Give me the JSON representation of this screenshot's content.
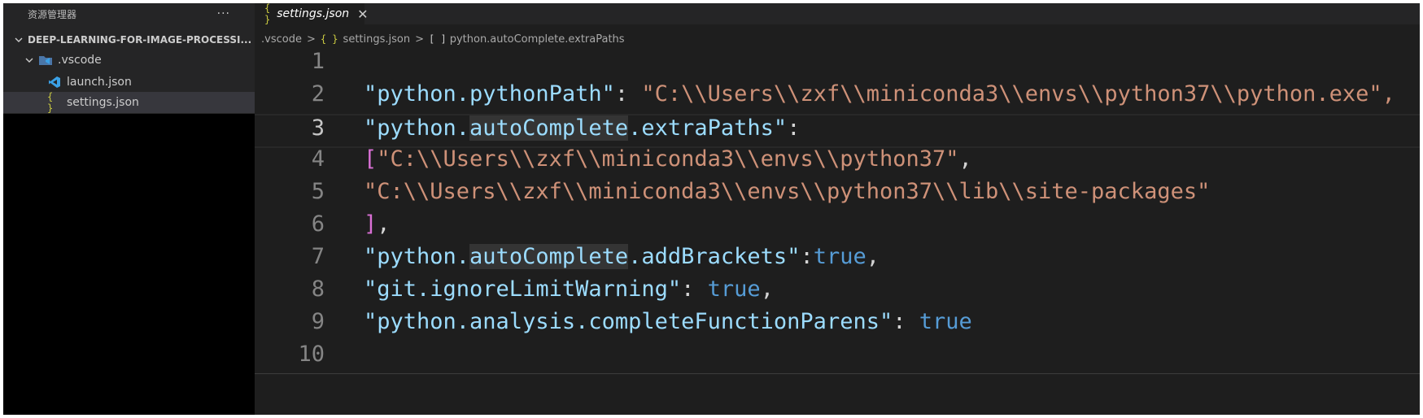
{
  "sidebar": {
    "title": "资源管理器",
    "more": "···",
    "folder": "DEEP-LEARNING-FOR-IMAGE-PROCESSI...",
    "items": [
      {
        "label": ".vscode"
      },
      {
        "label": "launch.json"
      },
      {
        "label": "settings.json"
      }
    ]
  },
  "tab": {
    "label": "settings.json",
    "close": "✕",
    "icon": "{ }"
  },
  "breadcrumb": {
    "parts": [
      ".vscode",
      "settings.json",
      "python.autoComplete.extraPaths"
    ],
    "separator": ">",
    "json_icon": "{ }",
    "array_icon": "[ ]"
  },
  "editor": {
    "line_numbers": [
      "1",
      "2",
      "3",
      "4",
      "5",
      "6",
      "7",
      "8",
      "9",
      "10"
    ],
    "current_line": 3,
    "lines": {
      "l2_key": "\"python.pythonPath\"",
      "l2_colon": ": ",
      "l2_val": "\"C:\\\\Users\\\\zxf\\\\miniconda3\\\\envs\\\\python37\\\\python.exe\",",
      "l3_key_a": "\"python.",
      "l3_key_b": "autoComplete",
      "l3_key_c": ".extraPaths\"",
      "l3_colon": ":",
      "l4_open": "[",
      "l4_val": "\"C:\\\\Users\\\\zxf\\\\miniconda3\\\\envs\\\\python37\"",
      "l4_comma": ",",
      "l5_val": "\"C:\\\\Users\\\\zxf\\\\miniconda3\\\\envs\\\\python37\\\\lib\\\\site-packages\"",
      "l6_close": "]",
      "l6_comma": ",",
      "l7_key_a": "\"python.",
      "l7_key_b": "autoComplete",
      "l7_key_c": ".addBrackets\"",
      "l7_colon": ":",
      "l7_val": "true",
      "l7_comma": ",",
      "l8_key": "\"git.ignoreLimitWarning\"",
      "l8_colon": ": ",
      "l8_val": "true",
      "l8_comma": ",",
      "l9_key": "\"python.analysis.completeFunctionParens\"",
      "l9_colon": ": ",
      "l9_val": "true"
    }
  },
  "colors": {
    "key": "#9cdcfe",
    "string": "#ce9178",
    "boolean": "#569cd6",
    "bracket": "#da70d6",
    "json_icon": "#cbcb41"
  }
}
